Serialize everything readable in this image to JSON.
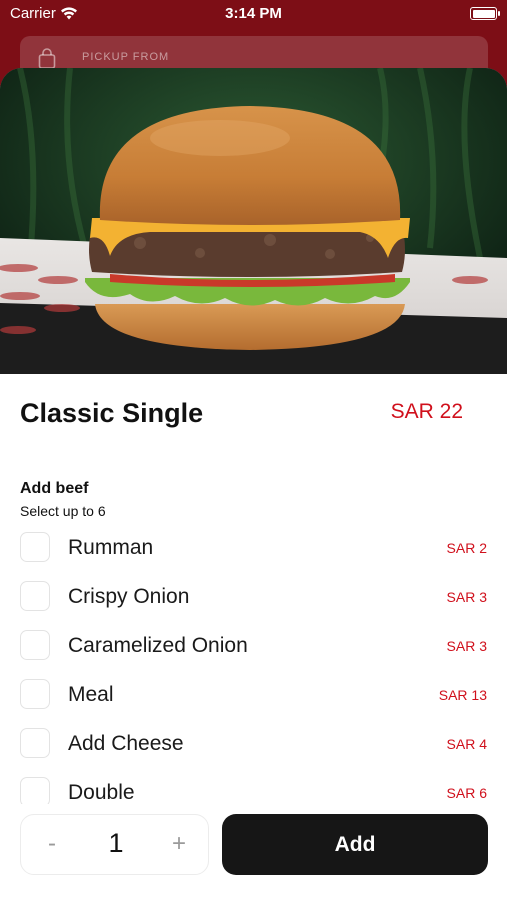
{
  "status_bar": {
    "carrier": "Carrier",
    "time": "3:14 PM"
  },
  "pickup": {
    "label": "PICKUP FROM"
  },
  "product": {
    "title": "Classic Single",
    "price": "SAR 22"
  },
  "modifier_group": {
    "title": "Add beef",
    "subtitle": "Select up to 6",
    "options": [
      {
        "label": "Rumman",
        "price": "SAR 2"
      },
      {
        "label": "Crispy Onion",
        "price": "SAR 3"
      },
      {
        "label": "Caramelized Onion",
        "price": "SAR 3"
      },
      {
        "label": "Meal",
        "price": "SAR 13"
      },
      {
        "label": "Add Cheese",
        "price": "SAR 4"
      },
      {
        "label": "Double",
        "price": "SAR 6"
      }
    ]
  },
  "quantity": {
    "minus": "-",
    "value": "1",
    "plus": "+"
  },
  "add_button": {
    "label": "Add"
  },
  "colors": {
    "brand_red": "#7d0e16",
    "price_red": "#d0101c",
    "button_dark": "#161616"
  },
  "icons": [
    "wifi-icon",
    "battery-icon",
    "bag-icon",
    "chevron-down-icon"
  ]
}
